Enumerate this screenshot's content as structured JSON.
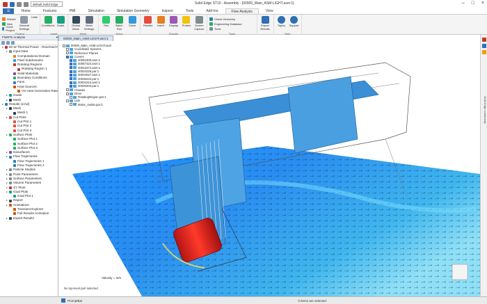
{
  "window": {
    "title": "Solid Edge ST10 - Assembly - [00000_Main_ASM-LIGHT.asm:1]",
    "document_combo": "default,Solid Edge"
  },
  "ribbon_tabs": [
    "Home",
    "Features",
    "PMI",
    "Simulation",
    "Simulation Geometry",
    "Inspect",
    "Tools",
    "Add-Ins",
    "Flow Analysis",
    "View"
  ],
  "active_tab": "Flow Analysis",
  "app_tab_label": "",
  "groups": [
    {
      "label": "Project",
      "buttons": [],
      "small": [
        "Wizard",
        "New",
        "Clone Project"
      ]
    },
    {
      "label": "Insert",
      "buttons": [
        "Conditions",
        "Goals"
      ],
      "small": []
    },
    {
      "label": "Mesh",
      "buttons": [
        "Global Mesh",
        "Mesh Settings"
      ],
      "small": []
    },
    {
      "label": "Solve",
      "buttons": [
        "Run",
        "Batch Run",
        "Solve"
      ],
      "small": []
    },
    {
      "label": "Results",
      "buttons": [
        "Results",
        "Insert",
        "Display",
        "Probes",
        "Screen Capture"
      ],
      "small": []
    },
    {
      "label": "Tools",
      "buttons": [],
      "small": [
        "Check Geometry",
        "Engineering Database",
        "Tools"
      ]
    },
    {
      "label": "",
      "buttons": [
        "Export Results"
      ],
      "small": []
    },
    {
      "label": "Help",
      "buttons": [
        "Topics",
        "Support"
      ],
      "small": []
    }
  ],
  "general_settings": "General Settings",
  "units": "Units",
  "left_panel": {
    "title": "FloEFD Analysis",
    "tree": [
      {
        "t": "60 W Thermal Power - Reversed Rotat",
        "d": 0,
        "c": "#c0392b"
      },
      {
        "t": "Input Data",
        "d": 1,
        "c": "#7f8c8d"
      },
      {
        "t": "Computational Domain",
        "d": 2,
        "c": "#e67e22"
      },
      {
        "t": "Fluid Subdomains",
        "d": 2,
        "c": "#3498db"
      },
      {
        "t": "Rotating Regions",
        "d": 2,
        "c": "#c0392b"
      },
      {
        "t": "Rotating Region 1",
        "d": 3,
        "c": "#c0392b"
      },
      {
        "t": "Solid Materials",
        "d": 2,
        "c": "#8e44ad"
      },
      {
        "t": "Boundary Conditions",
        "d": 2,
        "c": "#27ae60"
      },
      {
        "t": "Fans",
        "d": 2,
        "c": "#2980b9"
      },
      {
        "t": "Heat Sources",
        "d": 2,
        "c": "#d35400"
      },
      {
        "t": "VS Heat Generation Rate",
        "d": 3,
        "c": "#d35400"
      },
      {
        "t": "Goals",
        "d": 1,
        "c": "#16a085"
      },
      {
        "t": "Mesh",
        "d": 1,
        "c": "#2c3e50"
      },
      {
        "t": "Results (1/Ad)",
        "d": 0,
        "c": "#2980b9"
      },
      {
        "t": "Mesh",
        "d": 1,
        "c": "#2c3e50"
      },
      {
        "t": "Mesh 1",
        "d": 2,
        "c": "#2c3e50"
      },
      {
        "t": "Cut Plots",
        "d": 1,
        "c": "#e74c3c"
      },
      {
        "t": "Cut Plot 1",
        "d": 2,
        "c": "#e74c3c"
      },
      {
        "t": "Cut Plot 2",
        "d": 2,
        "c": "#e74c3c"
      },
      {
        "t": "Cut Plot 3",
        "d": 2,
        "c": "#e74c3c"
      },
      {
        "t": "Surface Plots",
        "d": 1,
        "c": "#27ae60"
      },
      {
        "t": "Surface Plot 1",
        "d": 2,
        "c": "#27ae60"
      },
      {
        "t": "Surface Plot 2",
        "d": 2,
        "c": "#27ae60"
      },
      {
        "t": "Surface Plot 3",
        "d": 2,
        "c": "#27ae60"
      },
      {
        "t": "Isosurfaces",
        "d": 1,
        "c": "#8e44ad"
      },
      {
        "t": "Flow Trajectories",
        "d": 1,
        "c": "#2980b9"
      },
      {
        "t": "Flow Trajectories 1",
        "d": 2,
        "c": "#2980b9"
      },
      {
        "t": "Flow Trajectories 2",
        "d": 2,
        "c": "#2980b9"
      },
      {
        "t": "Particle Studies",
        "d": 1,
        "c": "#7f8c8d"
      },
      {
        "t": "Point Parameters",
        "d": 1,
        "c": "#7f8c8d"
      },
      {
        "t": "Surface Parameters",
        "d": 1,
        "c": "#7f8c8d"
      },
      {
        "t": "Volume Parameters",
        "d": 1,
        "c": "#7f8c8d"
      },
      {
        "t": "XY Plots",
        "d": 1,
        "c": "#c0392b"
      },
      {
        "t": "Goal Plots",
        "d": 1,
        "c": "#16a085"
      },
      {
        "t": "Goal Plot 1",
        "d": 2,
        "c": "#16a085"
      },
      {
        "t": "Report",
        "d": 1,
        "c": "#34495e"
      },
      {
        "t": "Animations",
        "d": 1,
        "c": "#d35400"
      },
      {
        "t": "Transient Explorer",
        "d": 2,
        "c": "#d35400"
      },
      {
        "t": "Full Results Animation",
        "d": 2,
        "c": "#d35400"
      },
      {
        "t": "Export Results",
        "d": 1,
        "c": "#34495e"
      }
    ]
  },
  "doc_tab": "00000_Main_ASM-LIGHT.asm:1",
  "overlay_tree": [
    {
      "t": "00000_Main_ASM-LIGHT.asm",
      "d": 0,
      "on": false
    },
    {
      "t": "Coordinate Systems",
      "d": 1,
      "on": false
    },
    {
      "t": "Reference Planes",
      "d": 1,
      "on": false
    },
    {
      "t": "Covers",
      "d": 1,
      "on": true
    },
    {
      "t": "40053400.asm:1",
      "d": 2,
      "on": true
    },
    {
      "t": "40057424.asm:1",
      "d": 2,
      "on": true
    },
    {
      "t": "40043472.asm:1",
      "d": 2,
      "on": true
    },
    {
      "t": "40034226.par:1",
      "d": 2,
      "on": true
    },
    {
      "t": "40034027.asm:1",
      "d": 2,
      "on": true
    },
    {
      "t": "40035224.par:1",
      "d": 2,
      "on": true
    },
    {
      "t": "40034212.asm:1",
      "d": 2,
      "on": true
    },
    {
      "t": "40026202.par:1",
      "d": 2,
      "on": true
    },
    {
      "t": "Chassis",
      "d": 1,
      "on": false
    },
    {
      "t": "Drive",
      "d": 1,
      "on": false
    },
    {
      "t": "RotatingRegion.par:1",
      "d": 2,
      "on": false
    },
    {
      "t": "Lids",
      "d": 1,
      "on": false
    },
    {
      "t": "Motor_Inside.par:1",
      "d": 2,
      "on": false
    }
  ],
  "viewport_label": "Velocity = m/s",
  "selection_note": "No top-level part selected",
  "status": {
    "left": "PromptBar",
    "center": "0 items are selected"
  },
  "right_label": "Solid Edge community",
  "accent": "#2e6fb5"
}
